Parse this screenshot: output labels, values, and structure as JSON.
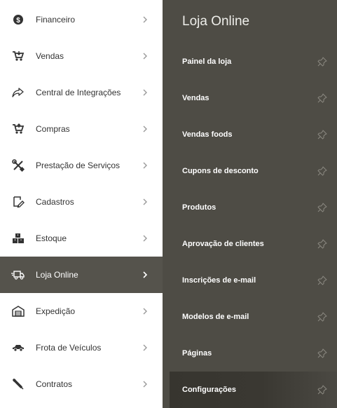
{
  "left_menu": {
    "items": [
      {
        "label": "Financeiro",
        "icon": "dollar-coin-icon"
      },
      {
        "label": "Vendas",
        "icon": "shopping-cart-icon"
      },
      {
        "label": "Central de Integrações",
        "icon": "share-arrow-icon"
      },
      {
        "label": "Compras",
        "icon": "shopping-cart-icon"
      },
      {
        "label": "Prestação de Serviços",
        "icon": "tools-icon"
      },
      {
        "label": "Cadastros",
        "icon": "edit-form-icon"
      },
      {
        "label": "Estoque",
        "icon": "boxes-icon"
      },
      {
        "label": "Loja Online",
        "icon": "delivery-truck-icon",
        "active": true
      },
      {
        "label": "Expedição",
        "icon": "warehouse-icon"
      },
      {
        "label": "Frota de Veículos",
        "icon": "car-icon"
      },
      {
        "label": "Contratos",
        "icon": "pen-icon"
      }
    ]
  },
  "submenu": {
    "title": "Loja Online",
    "items": [
      {
        "label": "Painel da loja"
      },
      {
        "label": "Vendas"
      },
      {
        "label": "Vendas foods"
      },
      {
        "label": "Cupons de desconto"
      },
      {
        "label": "Produtos"
      },
      {
        "label": "Aprovação de clientes"
      },
      {
        "label": "Inscrições de e-mail"
      },
      {
        "label": "Modelos de e-mail"
      },
      {
        "label": "Páginas"
      },
      {
        "label": "Configurações",
        "active": true
      }
    ]
  },
  "colors": {
    "submenu_bg": "#4e4c45",
    "active_left_bg": "#55534c",
    "active_sub_bg": "#37352f",
    "icon_dark": "#333333",
    "pin": "#8a8880"
  }
}
